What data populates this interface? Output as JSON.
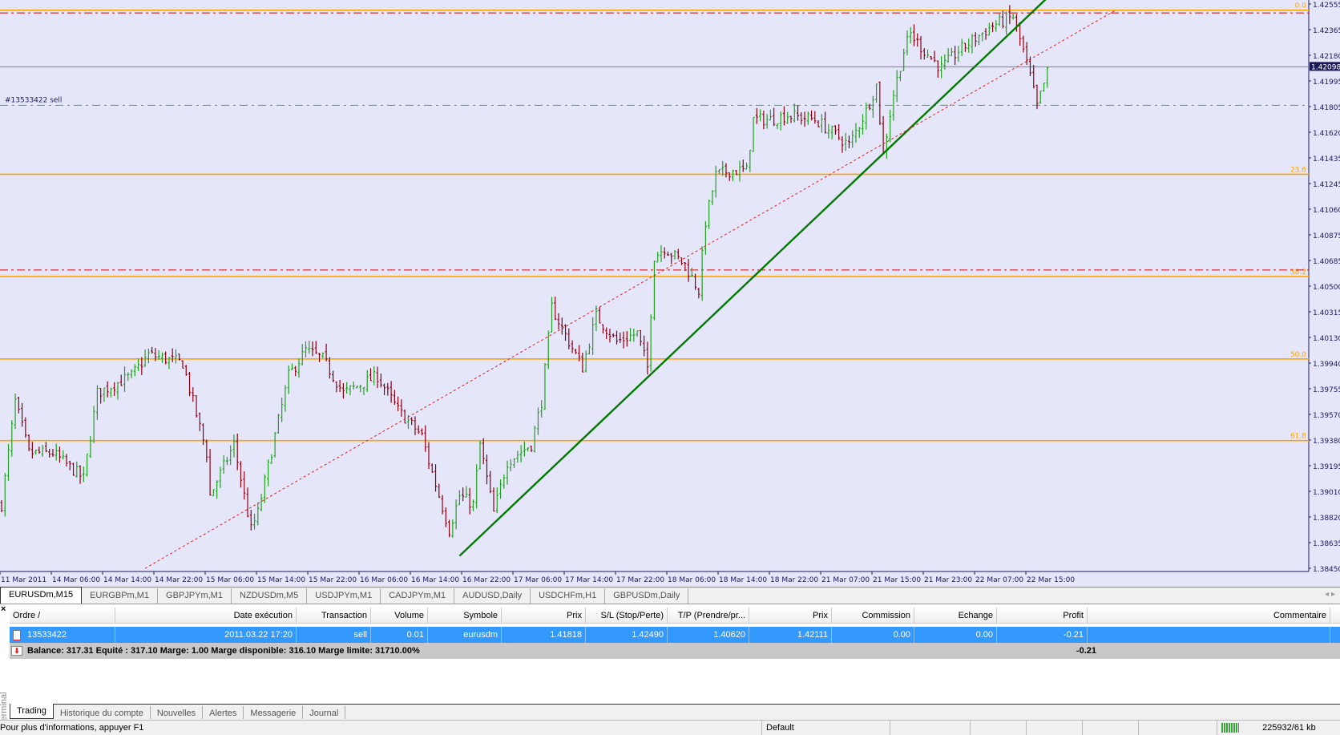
{
  "chart_tab": "EURUSDm,M15",
  "symbol_tabs": [
    "EURUSDm,M15",
    "EURGBPm,M1",
    "GBPJPYm,M1",
    "NZDUSDm,M5",
    "USDJPYm,M1",
    "CADJPYm,M1",
    "AUDUSD,Daily",
    "USDCHFm,H1",
    "GBPUSDm,Daily"
  ],
  "chart_data": {
    "type": "ohlc",
    "symbol": "EURUSDm",
    "timeframe": "M15",
    "price_ticks": [
      "1.42555",
      "1.42365",
      "1.42180",
      "1.41995",
      "1.41805",
      "1.41620",
      "1.41435",
      "1.41245",
      "1.41060",
      "1.40875",
      "1.40685",
      "1.40500",
      "1.40315",
      "1.40130",
      "1.39940",
      "1.39755",
      "1.39570",
      "1.39380",
      "1.39195",
      "1.39010",
      "1.38820",
      "1.38635",
      "1.38450"
    ],
    "ylim": [
      1.3845,
      1.42555
    ],
    "current_price": "1.42098",
    "time_ticks": [
      "11 Mar 2011",
      "14 Mar 06:00",
      "14 Mar 14:00",
      "14 Mar 22:00",
      "15 Mar 06:00",
      "15 Mar 14:00",
      "15 Mar 22:00",
      "16 Mar 06:00",
      "16 Mar 14:00",
      "16 Mar 22:00",
      "17 Mar 06:00",
      "17 Mar 14:00",
      "17 Mar 22:00",
      "18 Mar 06:00",
      "18 Mar 14:00",
      "18 Mar 22:00",
      "21 Mar 07:00",
      "21 Mar 15:00",
      "21 Mar 23:00",
      "22 Mar 07:00",
      "22 Mar 15:00"
    ],
    "bars_per_time_tick": 15,
    "price_path": [
      [
        0,
        1.38916
      ],
      [
        4,
        1.39663
      ],
      [
        8,
        1.39289
      ],
      [
        15,
        1.39289
      ],
      [
        24,
        1.39103
      ],
      [
        28,
        1.39725
      ],
      [
        38,
        1.39849
      ],
      [
        43,
        1.40005
      ],
      [
        53,
        1.39943
      ],
      [
        60,
        1.39289
      ],
      [
        61,
        1.38978
      ],
      [
        68,
        1.39352
      ],
      [
        73,
        1.3873
      ],
      [
        75,
        1.38854
      ],
      [
        80,
        1.39414
      ],
      [
        84,
        1.39849
      ],
      [
        89,
        1.40036
      ],
      [
        94,
        1.39974
      ],
      [
        100,
        1.39725
      ],
      [
        110,
        1.39849
      ],
      [
        116,
        1.396
      ],
      [
        123,
        1.39414
      ],
      [
        125,
        1.39227
      ],
      [
        131,
        1.3873
      ],
      [
        134,
        1.38978
      ],
      [
        138,
        1.38916
      ],
      [
        140,
        1.39352
      ],
      [
        144,
        1.38854
      ],
      [
        148,
        1.39227
      ],
      [
        155,
        1.39352
      ],
      [
        158,
        1.39663
      ],
      [
        161,
        1.40347
      ],
      [
        166,
        1.40098
      ],
      [
        170,
        1.39911
      ],
      [
        174,
        1.40285
      ],
      [
        180,
        1.40098
      ],
      [
        186,
        1.4016
      ],
      [
        189,
        1.39911
      ],
      [
        191,
        1.4072
      ],
      [
        194,
        1.40782
      ],
      [
        200,
        1.40658
      ],
      [
        204,
        1.40471
      ],
      [
        206,
        1.40969
      ],
      [
        209,
        1.41311
      ],
      [
        213,
        1.41342
      ],
      [
        218,
        1.41342
      ],
      [
        220,
        1.41715
      ],
      [
        225,
        1.41715
      ],
      [
        230,
        1.41746
      ],
      [
        238,
        1.41715
      ],
      [
        248,
        1.41529
      ],
      [
        253,
        1.41777
      ],
      [
        256,
        1.41964
      ],
      [
        258,
        1.41466
      ],
      [
        261,
        1.41902
      ],
      [
        264,
        1.42213
      ],
      [
        266,
        1.42337
      ],
      [
        270,
        1.42213
      ],
      [
        275,
        1.42088
      ],
      [
        280,
        1.42213
      ],
      [
        290,
        1.42399
      ],
      [
        296,
        1.42462
      ],
      [
        299,
        1.42213
      ],
      [
        301,
        1.42026
      ],
      [
        303,
        1.41809
      ],
      [
        306,
        1.42057
      ]
    ],
    "fibo_levels": [
      {
        "label": "0.0",
        "price": 1.4251
      },
      {
        "label": "23.6",
        "price": 1.41316
      },
      {
        "label": "38.2",
        "price": 1.40573
      },
      {
        "label": "50.0",
        "price": 1.39973
      },
      {
        "label": "61.8",
        "price": 1.39379
      }
    ],
    "stop_loss_line": 1.4249,
    "take_profit_line": 1.4062,
    "order_line": {
      "label": "#13533422 sell",
      "price": 1.41818
    },
    "trendline": [
      [
        134,
        1.3854
      ],
      [
        306,
        1.426
      ]
    ],
    "dotted_trendline": [
      [
        42,
        1.3845
      ],
      [
        326,
        1.4251
      ]
    ],
    "colors": {
      "background": "#e6e6fa",
      "bull": "#22a022",
      "bear": "#8b0010",
      "fibo": "#ffa500",
      "trend": "#007a00",
      "sl_tp": "#d00000",
      "order": "#33bb33"
    }
  },
  "table": {
    "headers": [
      "Ordre  /",
      "Date exécution",
      "Transaction",
      "Volume",
      "Symbole",
      "Prix",
      "S/L (Stop/Perte)",
      "T/P (Prendre/pr...",
      "Prix",
      "Commission",
      "Echange",
      "Profit",
      "Commentaire"
    ],
    "row": [
      "13533422",
      "2011.03.22 17:20",
      "sell",
      "0.01",
      "eurusdm",
      "1.41818",
      "1.42490",
      "1.40620",
      "1.42111",
      "0.00",
      "0.00",
      "-0.21",
      ""
    ],
    "balance": "Balance: 317.31  Equité : 317.10  Marge: 1.00  Marge disponible: 316.10  Marge limite: 31710.00%",
    "total_profit": "-0.21"
  },
  "terminal_label": "Terminal",
  "bottom_tabs": [
    "Trading",
    "Historique du compte",
    "Nouvelles",
    "Alertes",
    "Messagerie",
    "Journal"
  ],
  "status": {
    "help": "Pour plus d'informations, appuyer F1",
    "profile": "Default",
    "traffic": "225932/61 kb"
  }
}
